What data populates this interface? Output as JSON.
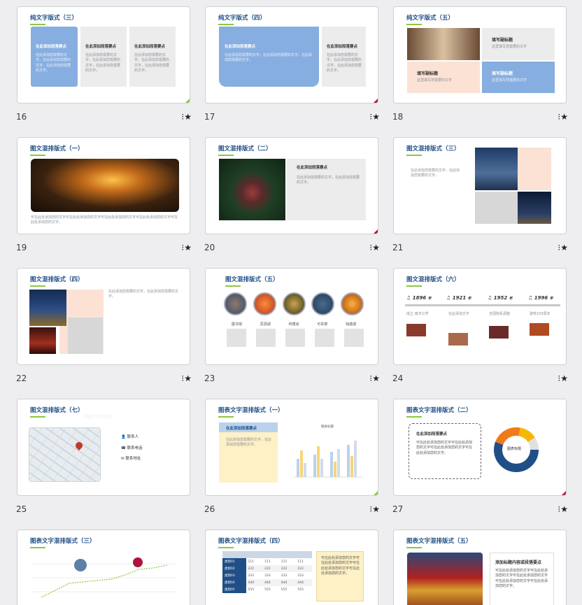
{
  "slides": [
    {
      "num": "16",
      "title": "纯文字版式（三）",
      "heads": [
        "在此添加段落要点",
        "在此添加段落要点",
        "在此添加段落要点"
      ],
      "body": "在此添加您需要的文字，在此添加您需要的文字，在此添加您需要的文字。"
    },
    {
      "num": "17",
      "title": "纯文字版式（四）",
      "heads": [
        "在此添加段落要点",
        "在此添加段落要点"
      ],
      "body": "在此添加您需要的文字，在此添加您需要的文字，在此添加您需要的文字。"
    },
    {
      "num": "18",
      "title": "纯文字版式（五）",
      "heads": [
        "填写副标题",
        "填写副标题",
        "填写副标题"
      ],
      "sub": "这里填写您需要的文字"
    },
    {
      "num": "19",
      "title": "图文混排版式（一）",
      "caption": "可在此处添加您的文字可在此处添加您的文字可在此处添加您的文字可在此处添加您的文字可在此处添加您的文字。"
    },
    {
      "num": "20",
      "title": "图文混排版式（二）",
      "heads": [
        "在此添加段落要点"
      ],
      "body": "在此添加您需要的文字，在此添加您需要的文字。"
    },
    {
      "num": "21",
      "title": "图文混排版式（三）",
      "body": "在此添加您需要的文字，在此添加您需要的文字。"
    },
    {
      "num": "22",
      "title": "图文混排版式（四）",
      "body": "在此添加您需要的文字，在此添加您需要的文字。"
    },
    {
      "num": "23",
      "title": "图文混排版式（五）",
      "labels": [
        "图书馆",
        "思源湖",
        "林荫道",
        "可青楼",
        "钱塘湖"
      ]
    },
    {
      "num": "24",
      "title": "图文混排版式（六）",
      "years": [
        "1896",
        "1921",
        "1952",
        "1996"
      ],
      "year_suffix": "年",
      "notes": [
        "成立\n南洋公学",
        "在此添加文字",
        "全国院系调整",
        "建校100周年"
      ]
    },
    {
      "num": "25",
      "title": "图文混排版式（七）",
      "watermark": "Add HERE",
      "contacts": [
        "联系人",
        "联系电话",
        "联系地址"
      ]
    },
    {
      "num": "26",
      "title": "图表文字混排版式（一）",
      "heads": [
        "在此添加段落要点"
      ],
      "chart_title": "图表标题",
      "body": "在此添加您需要的文字，在此添加您需要的文字。"
    },
    {
      "num": "27",
      "title": "图表文字混排版式（二）",
      "heads": [
        "在此添加段落要点"
      ],
      "donut_label": "图表标题",
      "body": "可在此处添加您的文字可在此处添加您的文字可在此处添加您的文字可在此处添加您的文字。"
    },
    {
      "num": "28",
      "title": "图表文字混排版式（三）"
    },
    {
      "num": "29",
      "title": "图表文字混排版式（四）",
      "table_rows": [
        [
          "类别01",
          "111",
          "111",
          "111",
          "111"
        ],
        [
          "类别02",
          "222",
          "222",
          "222",
          "222"
        ],
        [
          "类别03",
          "333",
          "333",
          "333",
          "333"
        ],
        [
          "类别04",
          "444",
          "444",
          "444",
          "444"
        ],
        [
          "类别05",
          "555",
          "555",
          "555",
          "555"
        ]
      ],
      "body": "可在此处添加您的文字可在此处添加您的文字可在此处添加您的文字可在此处添加您的文字。"
    },
    {
      "num": "30",
      "title": "图表文字混排版式（五）",
      "heads": [
        "添加标题内容或段落要点"
      ],
      "body": "可在此处添加您的文字可在此处添加您的文字可在此处添加您的文字可在此处添加您的文字可在此处添加您的文字。"
    }
  ],
  "star_glyph": "⁝★",
  "colors": {
    "title": "#1f4f86",
    "accent_green": "#8ec63f",
    "blue_block": "#87aee0",
    "peach": "#fbe2d5",
    "grey": "#ececec",
    "red": "#b0143b"
  }
}
